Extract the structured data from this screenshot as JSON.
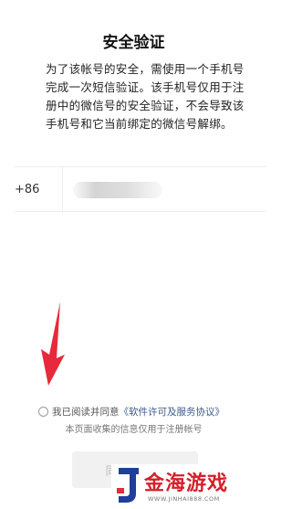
{
  "title": "安全验证",
  "description": "为了该帐号的安全，需使用一个手机号完成一次短信验证。该手机号仅用于注册中的微信号的安全验证，不会导致该手机号和它当前绑定的微信号解绑。",
  "phone": {
    "country_code": "+86",
    "value": ""
  },
  "agreement": {
    "prefix": "我已阅读并同意",
    "link": "《软件许可及服务协议》",
    "checked": false
  },
  "notice": "本页面收集的信息仅用于注册帐号",
  "next_button": {
    "label": "同意并继续"
  },
  "watermark": {
    "brand": "金海游戏",
    "url": "WWW.JINHAI888.COM"
  },
  "colors": {
    "annotation_arrow": "#e8293b",
    "link": "#3b5a86",
    "watermark_red": "#d5202a"
  }
}
